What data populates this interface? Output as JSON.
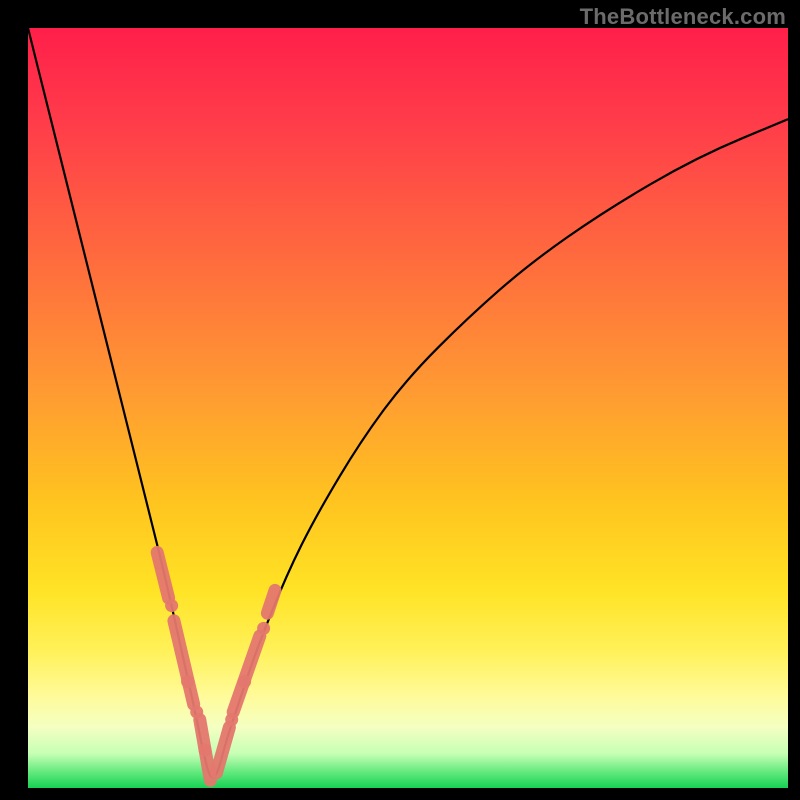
{
  "watermark": "TheBottleneck.com",
  "colors": {
    "curve": "#000000",
    "marker": "#e4776e",
    "gradient_stops": [
      {
        "pct": 0,
        "hex": "#ff1f4a"
      },
      {
        "pct": 12,
        "hex": "#ff3b4a"
      },
      {
        "pct": 30,
        "hex": "#ff6a3e"
      },
      {
        "pct": 48,
        "hex": "#ff9b32"
      },
      {
        "pct": 62,
        "hex": "#ffc31f"
      },
      {
        "pct": 74,
        "hex": "#ffe325"
      },
      {
        "pct": 82,
        "hex": "#fff15a"
      },
      {
        "pct": 88,
        "hex": "#fffb9a"
      },
      {
        "pct": 92,
        "hex": "#f4ffc2"
      },
      {
        "pct": 95.5,
        "hex": "#c6ffb4"
      },
      {
        "pct": 98,
        "hex": "#5fe87b"
      },
      {
        "pct": 100,
        "hex": "#17d154"
      }
    ]
  },
  "chart_data": {
    "type": "line",
    "title": "",
    "xlabel": "",
    "ylabel": "",
    "x_range": [
      0,
      100
    ],
    "y_range_bottleneck_pct": [
      0,
      100
    ],
    "notes": "V-shaped bottleneck curve: background encodes bottleneck percent (top=100% red, bottom=0% green). X is an unlabeled component-balance axis. Minimum at x≈24.",
    "series": [
      {
        "name": "bottleneck-curve",
        "x": [
          0,
          3,
          6,
          9,
          12,
          15,
          18,
          20,
          22,
          23,
          24,
          25,
          26,
          28,
          30,
          34,
          38,
          44,
          50,
          58,
          66,
          76,
          88,
          100
        ],
        "bottleneck": [
          100,
          88,
          76,
          64,
          52,
          40,
          28,
          19,
          10,
          5,
          1,
          2,
          6,
          12,
          18,
          28,
          36,
          46,
          54,
          62,
          69,
          76,
          83,
          88
        ]
      }
    ],
    "markers": {
      "comment": "Salmon-colored overlay segments and dots highlighting the near-zero-bottleneck region on both legs of the V.",
      "left_leg_segments": [
        {
          "x0": 17.0,
          "b0": 31,
          "x1": 18.5,
          "b1": 25
        },
        {
          "x0": 19.2,
          "b0": 22,
          "x1": 21.8,
          "b1": 11
        },
        {
          "x0": 22.6,
          "b0": 9,
          "x1": 24.0,
          "b1": 1
        }
      ],
      "right_leg_segments": [
        {
          "x0": 24.8,
          "b0": 2,
          "x1": 26.5,
          "b1": 8
        },
        {
          "x0": 27.0,
          "b0": 10,
          "x1": 30.5,
          "b1": 20
        },
        {
          "x0": 31.5,
          "b0": 23,
          "x1": 32.5,
          "b1": 26
        }
      ],
      "left_leg_dots": [
        {
          "x": 18.9,
          "b": 24
        },
        {
          "x": 21.0,
          "b": 14
        },
        {
          "x": 22.2,
          "b": 10
        },
        {
          "x": 23.3,
          "b": 5
        }
      ],
      "right_leg_dots": [
        {
          "x": 26.8,
          "b": 9
        },
        {
          "x": 28.5,
          "b": 14
        },
        {
          "x": 31.0,
          "b": 21
        }
      ]
    }
  }
}
